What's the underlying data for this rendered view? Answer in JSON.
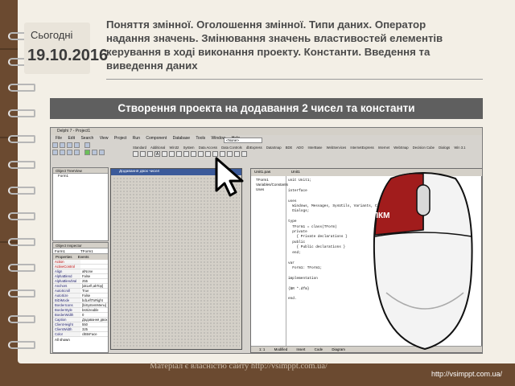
{
  "date_box": {
    "label": "Сьогодні",
    "value": "19.10.2016"
  },
  "header": {
    "line1": "Поняття змінної. Оголошення змінної. Типи даних. Оператор",
    "line2": "надання значень. Змінювання значень властивостей елементів",
    "line3": "керування в ході виконання проекту. Константи. Введення та",
    "line4": "виведення даних"
  },
  "slide_title": "Створення проекта на додавання 2 чисел та константи",
  "ide": {
    "window_title": "Delphi 7 - Project1",
    "menu": [
      "File",
      "Edit",
      "Search",
      "View",
      "Project",
      "Run",
      "Component",
      "Database",
      "Tools",
      "Window",
      "Help"
    ],
    "combo_value": "<None>",
    "palette_tabs": [
      "Standard",
      "Additional",
      "Win32",
      "System",
      "Data Access",
      "Data Controls",
      "dbExpress",
      "DataSnap",
      "BDE",
      "ADO",
      "InterBase",
      "WebServices",
      "InternetExpress",
      "Internet",
      "WebSnap",
      "Decision Cube",
      "Dialogs",
      "Win 3.1"
    ],
    "tree_view": {
      "title": "Object TreeView",
      "items": [
        "Form1"
      ]
    },
    "inspector": {
      "title": "Object Inspector",
      "selector": "Form1",
      "selector_type": "TForm1",
      "tabs": [
        "Properties",
        "Events"
      ],
      "rows": [
        {
          "key": "Action",
          "value": ""
        },
        {
          "key": "ActiveControl",
          "value": ""
        },
        {
          "key": "Align",
          "value": "alNone"
        },
        {
          "key": "AlphaBlend",
          "value": "False"
        },
        {
          "key": "AlphaBlendVal",
          "value": "255"
        },
        {
          "key": "Anchors",
          "value": "[akLeft,akTop]"
        },
        {
          "key": "AutoScroll",
          "value": "True"
        },
        {
          "key": "AutoSize",
          "value": "False"
        },
        {
          "key": "BiDiMode",
          "value": "bdLeftToRight"
        },
        {
          "key": "BorderIcons",
          "value": "[biSystemMenu]"
        },
        {
          "key": "BorderStyle",
          "value": "bsSizeable"
        },
        {
          "key": "BorderWidth",
          "value": "0"
        },
        {
          "key": "Caption",
          "value": "Додавання двох чисел"
        },
        {
          "key": "ClientHeight",
          "value": "550"
        },
        {
          "key": "ClientWidth",
          "value": "325"
        },
        {
          "key": "Color",
          "value": "clBtnFace"
        }
      ],
      "footer": "All shown"
    },
    "form_caption": "Додавання двох чисел",
    "editor": {
      "tab_file": "Unit1.pas",
      "tab_unit": "Unit1",
      "tree": [
        "TForm1",
        "Variables/Constants",
        "Uses"
      ],
      "code": "unit Unit1;\n\ninterface\n\nuses\n  Windows, Messages, SysUtils, Variants, Classes, Graphics, Controls, Forms,\n  Dialogs;\n\ntype\n  TForm1 = class(TForm)\n  private\n    { Private declarations }\n  public\n    { Public declarations }\n  end;\n\nvar\n  Form1: TForm1;\n\nimplementation\n\n{$R *.dfm}\n\nend.",
      "status": [
        "1: 1",
        "Modified",
        "Insert",
        "Code",
        "Diagram"
      ]
    },
    "mouse_label": "ЛКМ"
  },
  "watermark": "Матеріал є власністю сайту http://vsimppt.com.ua/",
  "footer_url": "http://vsimppt.com.ua/",
  "colors": {
    "title_bar": "#5f5f5f",
    "mouse_red": "#b22222",
    "paper": "#f3efe6"
  }
}
